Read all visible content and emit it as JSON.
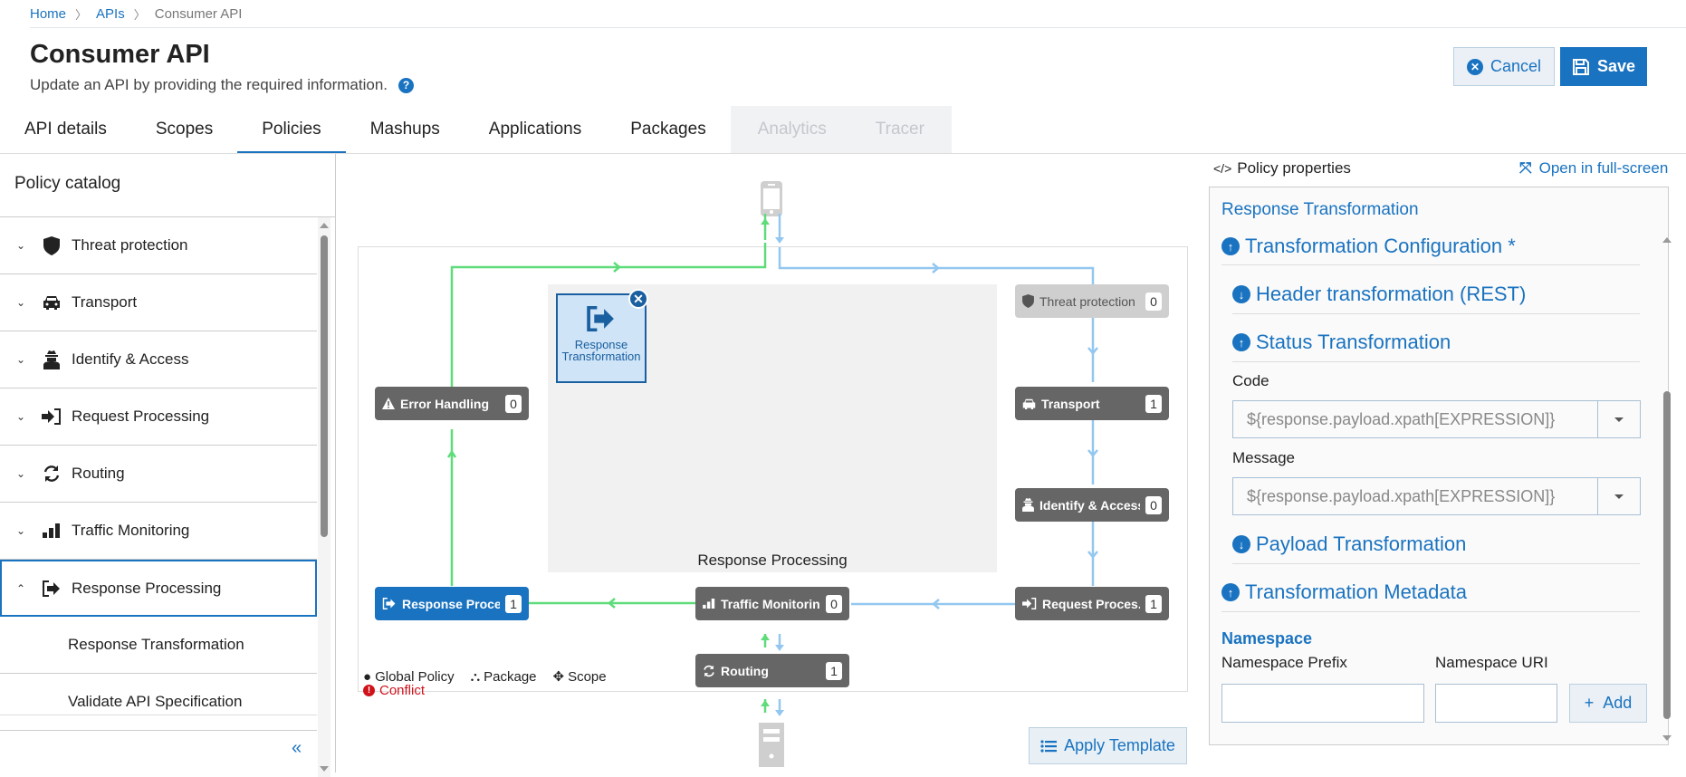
{
  "breadcrumb": [
    "Home",
    "APIs",
    "Consumer API"
  ],
  "header": {
    "title": "Consumer API",
    "subtitle": "Update an API by providing the required information.",
    "cancel_label": "Cancel",
    "save_label": "Save"
  },
  "tabs": [
    {
      "label": "API details",
      "state": "normal"
    },
    {
      "label": "Scopes",
      "state": "normal"
    },
    {
      "label": "Policies",
      "state": "active"
    },
    {
      "label": "Mashups",
      "state": "normal"
    },
    {
      "label": "Applications",
      "state": "normal"
    },
    {
      "label": "Packages",
      "state": "normal"
    },
    {
      "label": "Analytics",
      "state": "disabled"
    },
    {
      "label": "Tracer",
      "state": "disabled"
    }
  ],
  "catalog": {
    "title": "Policy catalog",
    "items": [
      {
        "label": "Threat protection",
        "icon": "shield-icon",
        "expanded": false
      },
      {
        "label": "Transport",
        "icon": "car-icon",
        "expanded": false
      },
      {
        "label": "Identify & Access",
        "icon": "user-secret-icon",
        "expanded": false
      },
      {
        "label": "Request Processing",
        "icon": "sign-in-icon",
        "expanded": false
      },
      {
        "label": "Routing",
        "icon": "refresh-icon",
        "expanded": false
      },
      {
        "label": "Traffic Monitoring",
        "icon": "bar-chart-icon",
        "expanded": false
      },
      {
        "label": "Response Processing",
        "icon": "sign-out-icon",
        "expanded": true,
        "selected": true
      }
    ],
    "sub_items": [
      "Response Transformation",
      "Validate API Specification"
    ],
    "collapse_label": "«"
  },
  "diagram": {
    "stage_label": "Response Processing",
    "policy_card": {
      "label": "Response Transformation",
      "icon": "sign-out-icon"
    },
    "nodes": {
      "threat": {
        "label": "Threat protection",
        "count": "0"
      },
      "transport": {
        "label": "Transport",
        "count": "1"
      },
      "identify": {
        "label": "Identify & Access",
        "count": "0"
      },
      "request": {
        "label": "Request Proces...",
        "count": "1"
      },
      "traffic": {
        "label": "Traffic Monitoring",
        "count": "0"
      },
      "routing": {
        "label": "Routing",
        "count": "1"
      },
      "response": {
        "label": "Response Proce...",
        "count": "1"
      },
      "error": {
        "label": "Error Handling",
        "count": "0"
      }
    },
    "legend": {
      "global": "Global Policy",
      "package": "Package",
      "scope": "Scope",
      "conflict": "Conflict"
    },
    "apply_template_label": "Apply Template",
    "colors": {
      "response_flow": "#5fdc7a",
      "request_flow": "#93c7ef",
      "accent": "#1a73c0"
    }
  },
  "properties": {
    "heading": "Policy properties",
    "fullscreen_label": "Open in full-screen",
    "policy_title": "Response Transformation",
    "sections": {
      "config": "Transformation Configuration *",
      "header": "Header transformation (REST)",
      "status": "Status Transformation",
      "payload": "Payload Transformation",
      "metadata": "Transformation Metadata"
    },
    "code_label": "Code",
    "code_value": "${response.payload.xpath[EXPRESSION]}",
    "message_label": "Message",
    "message_value": "${response.payload.xpath[EXPRESSION]}",
    "namespace_heading": "Namespace",
    "ns_prefix_label": "Namespace Prefix",
    "ns_prefix_value": "",
    "ns_uri_label": "Namespace URI",
    "ns_uri_value": "",
    "add_label": "Add"
  }
}
